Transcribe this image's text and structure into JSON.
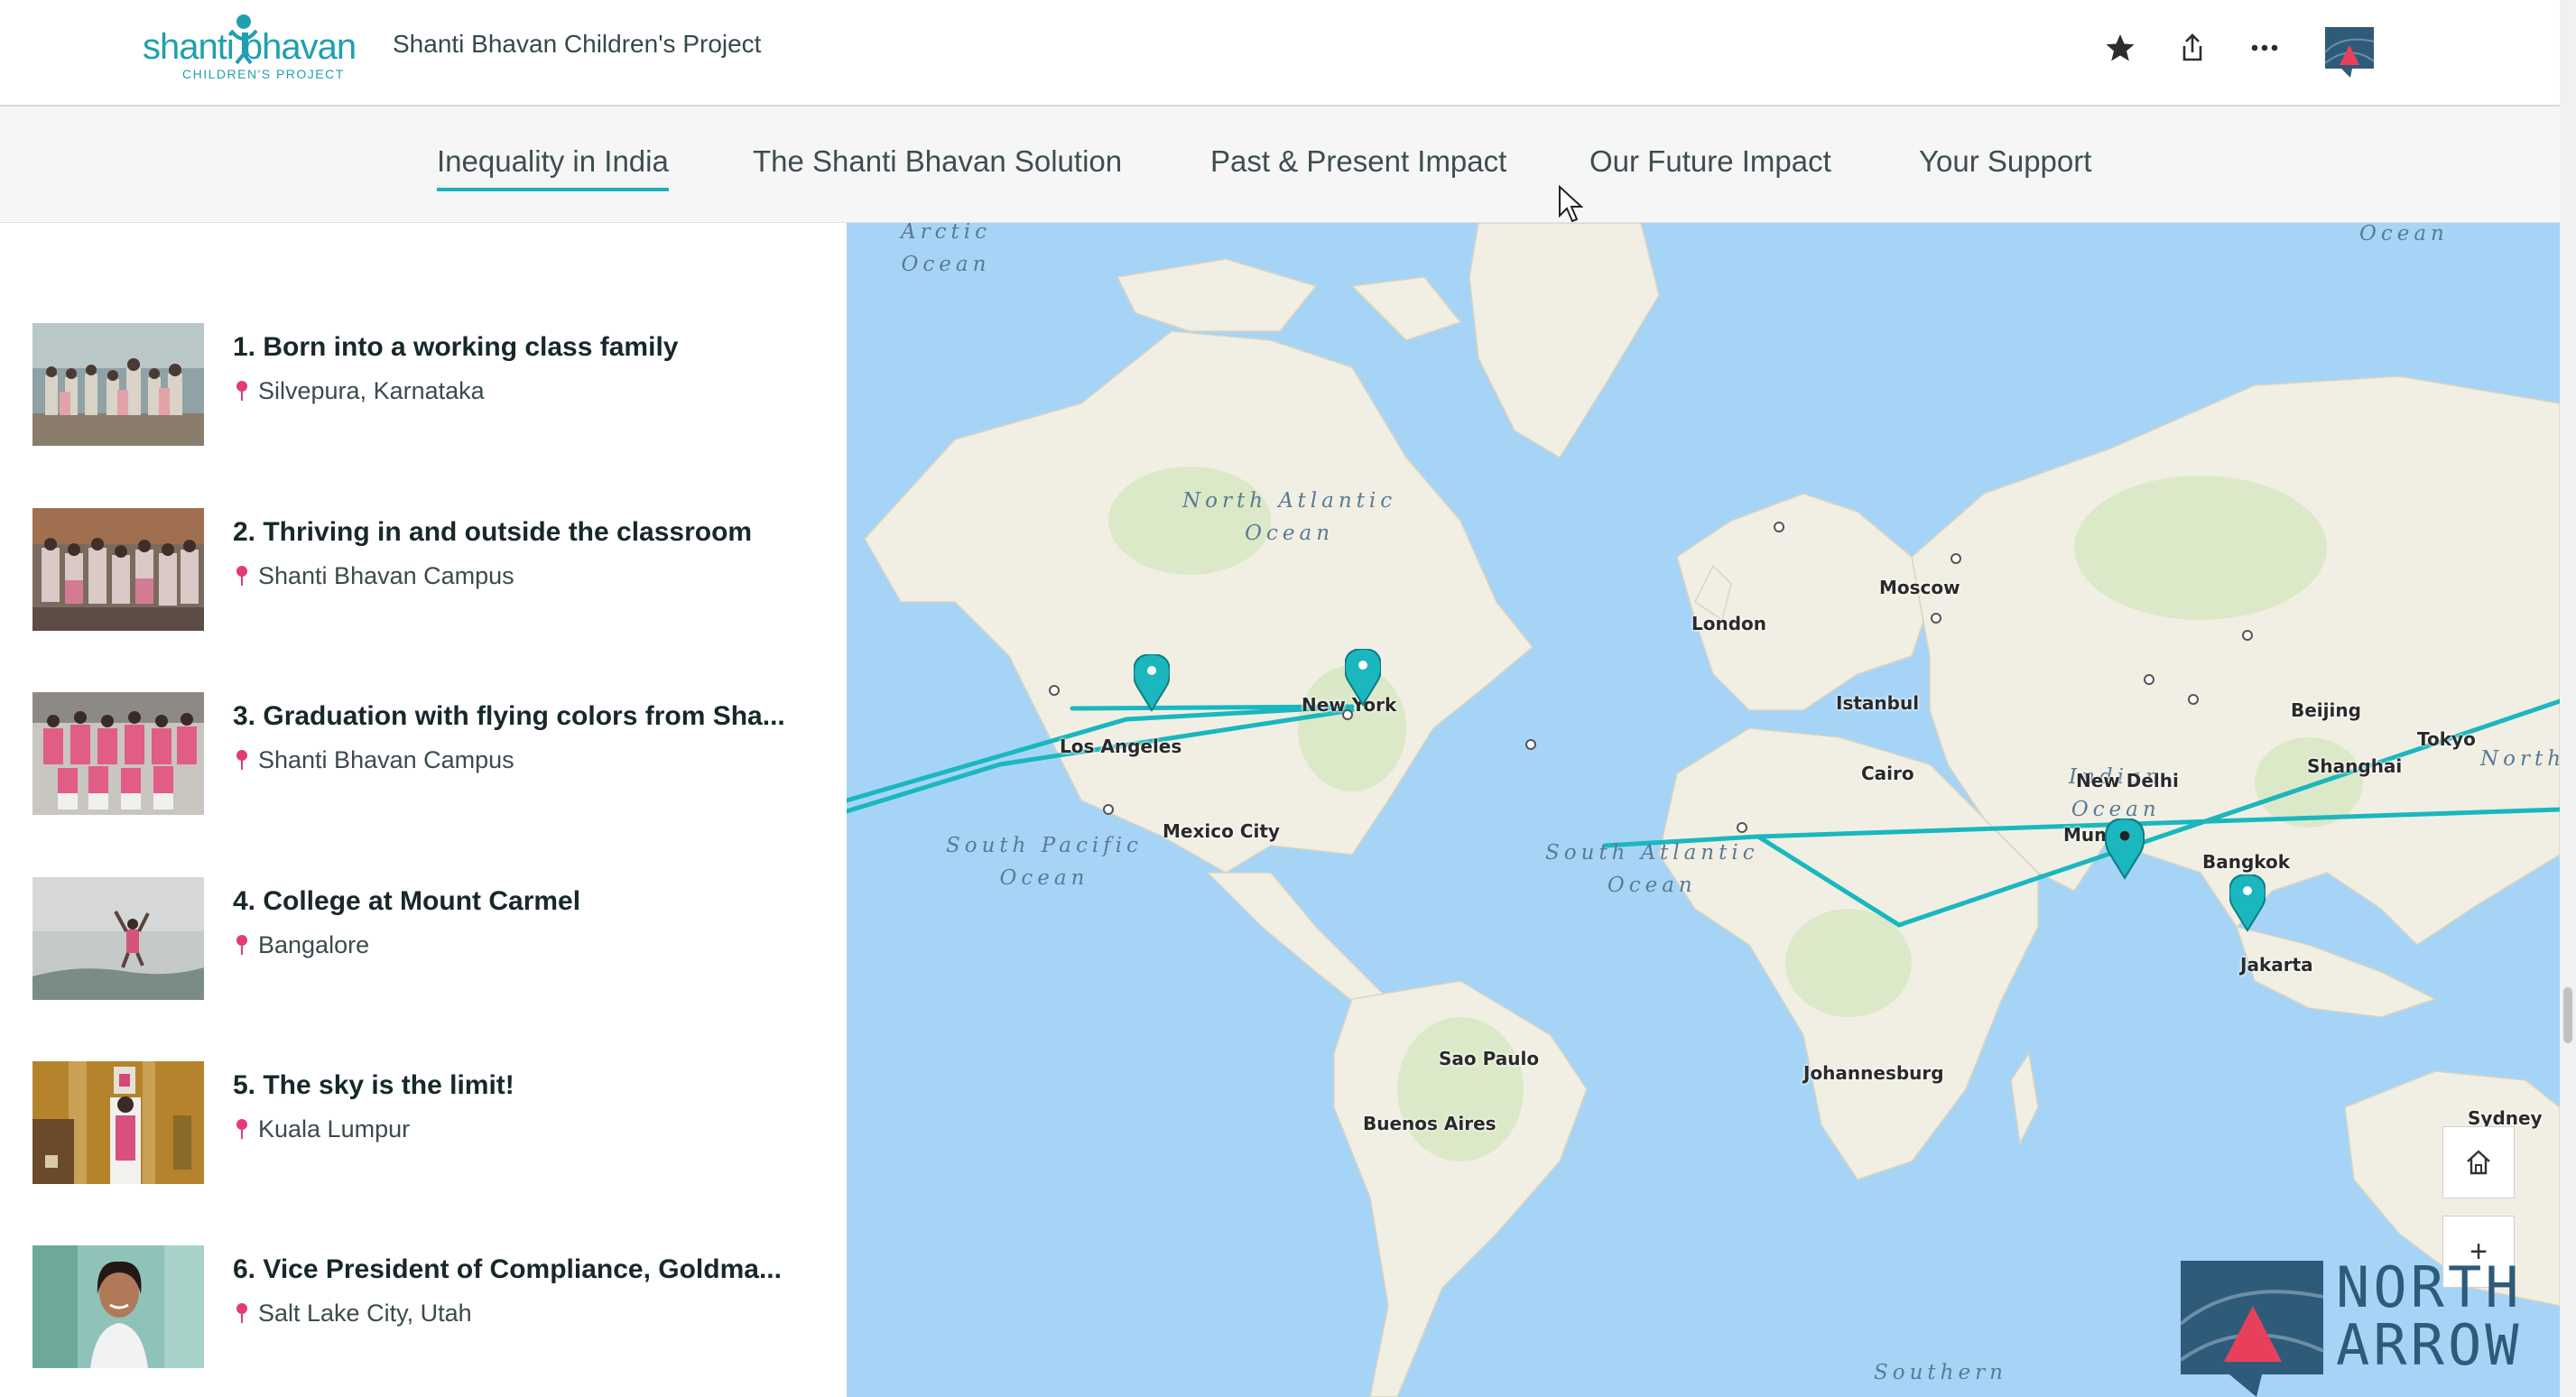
{
  "header": {
    "logo_word": "shanti bhavan",
    "logo_sub": "CHILDREN'S PROJECT",
    "title": "Shanti Bhavan Children's Project",
    "favorite_icon": "star-icon",
    "share_icon": "share-icon",
    "more_icon": "more-icon",
    "avatar_icon": "north-arrow-avatar"
  },
  "nav": {
    "items": [
      {
        "label": "Inequality in India",
        "active": true
      },
      {
        "label": "The Shanti Bhavan Solution",
        "active": false
      },
      {
        "label": "Past & Present Impact",
        "active": false
      },
      {
        "label": "Our Future Impact",
        "active": false
      },
      {
        "label": "Your Support",
        "active": false
      }
    ]
  },
  "stories": [
    {
      "title": "1. Born into a working class family",
      "location": "Silvepura, Karnataka"
    },
    {
      "title": "2. Thriving in and outside the classroom",
      "location": "Shanti Bhavan Campus"
    },
    {
      "title": "3. Graduation with flying colors from Sha...",
      "location": "Shanti Bhavan Campus"
    },
    {
      "title": "4. College at Mount Carmel",
      "location": "Bangalore"
    },
    {
      "title": "5. The sky is the limit!",
      "location": "Kuala Lumpur"
    },
    {
      "title": "6. Vice President of Compliance, Goldma...",
      "location": "Salt Lake City, Utah"
    }
  ],
  "map": {
    "cities": [
      "Moscow",
      "London",
      "Istanbul",
      "Beijing",
      "Tokyo",
      "Shanghai",
      "New Delhi",
      "Cairo",
      "Mum",
      "Bangkok",
      "Jakarta",
      "New York",
      "Los Angeles",
      "Mexico City",
      "Sao Paulo",
      "Buenos Aires",
      "Johannesburg",
      "Sydney"
    ],
    "oceans": {
      "arctic": [
        "Arctic",
        "Ocean"
      ],
      "north_atlantic": [
        "North Atlantic",
        "Ocean"
      ],
      "south_pacific": [
        "South Pacific",
        "Ocean"
      ],
      "south_atlantic": [
        "South Atlantic",
        "Ocean"
      ],
      "indian": [
        "Indian",
        "Ocean"
      ],
      "top_right": "Ocean",
      "north_right": "North",
      "southern": "Southern"
    },
    "home_icon": "home-icon",
    "zoom_in_label": "+",
    "watermark": {
      "line1": "NORTH",
      "line2": "ARROW"
    },
    "colors": {
      "water": "#a6d4f7",
      "land": "#f1efe4",
      "route": "#1ab7be",
      "pin": "#1ab7be"
    }
  }
}
